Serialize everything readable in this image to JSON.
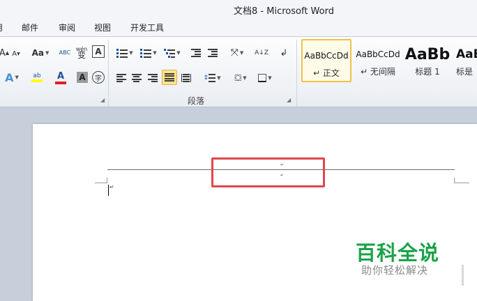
{
  "window": {
    "title": "文档8  -  Microsoft Word"
  },
  "tabs": [
    {
      "label": "用"
    },
    {
      "label": "邮件"
    },
    {
      "label": "审阅"
    },
    {
      "label": "视图"
    },
    {
      "label": "开发工具"
    }
  ],
  "ribbon": {
    "font": {
      "grow_font_label": "A",
      "shrink_font_label": "A",
      "change_case_label": "Aa",
      "clear_format_label": "ABC",
      "phonetic_label": "wén",
      "phonetic_char": "变",
      "char_border_label": "A",
      "text_effect_label": "A",
      "highlight_label": "ab",
      "font_color_label": "A",
      "char_shading_label": "A",
      "enclose_char_label": "字"
    },
    "paragraph": {
      "group_label": "段落",
      "sort_label": "A↓Z"
    },
    "styles": [
      {
        "sample": "AaBbCcDd",
        "name": "↵ 正文",
        "selected": true
      },
      {
        "sample": "AaBbCcDd",
        "name": "↵ 无间隔",
        "selected": false
      },
      {
        "sample": "AaBb",
        "name": "标题 1",
        "selected": false
      },
      {
        "sample": "AaB",
        "name": "标是",
        "selected": false
      }
    ]
  },
  "document": {
    "header_mark_1": "↵",
    "header_mark_2": "↵",
    "body_mark": "↵"
  },
  "watermark": {
    "title": "百科全说",
    "subtitle": "助你轻松解决"
  },
  "colors": {
    "highlight_box": "#e0464c",
    "watermark_green": "#1aa34a",
    "selected_style_border": "#f0c14b"
  }
}
